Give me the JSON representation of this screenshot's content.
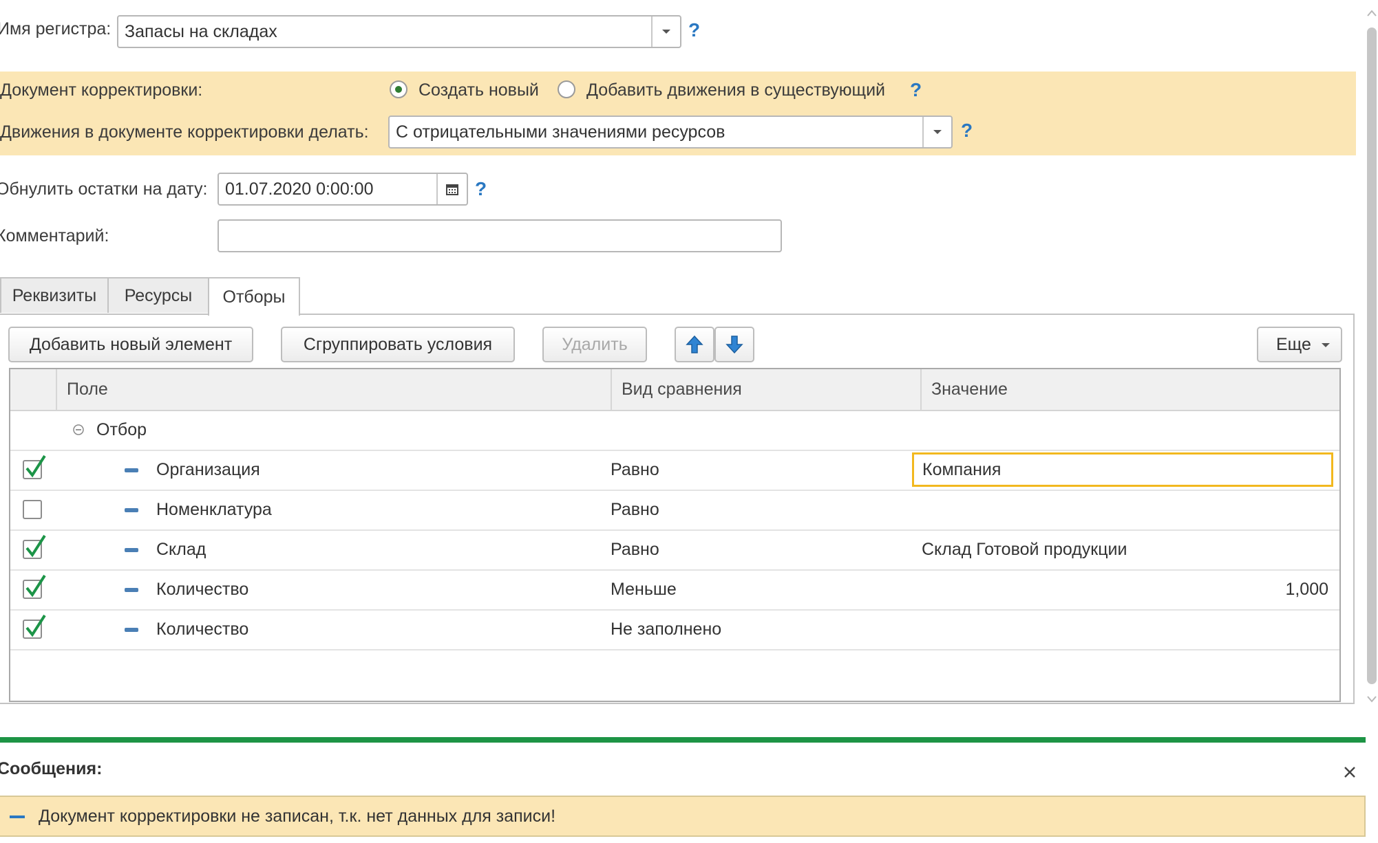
{
  "register": {
    "label": "Имя регистра:",
    "value": "Запасы на складах",
    "help": "?"
  },
  "correction": {
    "label": "Документ корректировки:",
    "options": [
      {
        "label": "Создать новый",
        "selected": true
      },
      {
        "label": "Добавить движения в существующий",
        "selected": false
      }
    ],
    "help": "?",
    "movements_label": "Движения в документе корректировки делать:",
    "movements_value": "С отрицательными значениями ресурсов",
    "movements_help": "?"
  },
  "reset": {
    "label": "Обнулить остатки на дату:",
    "value": "01.07.2020  0:00:00",
    "help": "?"
  },
  "comment": {
    "label": "Комментарий:",
    "value": ""
  },
  "tabs": [
    {
      "label": "Реквизиты",
      "active": false
    },
    {
      "label": "Ресурсы",
      "active": false
    },
    {
      "label": "Отборы",
      "active": true
    }
  ],
  "toolbar": {
    "add_label": "Добавить новый элемент",
    "group_label": "Сгруппировать условия",
    "delete_label": "Удалить",
    "more_label": "Еще"
  },
  "grid": {
    "columns": [
      "Поле",
      "Вид сравнения",
      "Значение"
    ],
    "group": "Отбор",
    "rows": [
      {
        "checked": true,
        "field": "Организация",
        "comparison": "Равно",
        "value": "Компания"
      },
      {
        "checked": false,
        "field": "Номенклатура",
        "comparison": "Равно",
        "value": ""
      },
      {
        "checked": true,
        "field": "Склад",
        "comparison": "Равно",
        "value": "Склад Готовой продукции"
      },
      {
        "checked": true,
        "field": "Количество",
        "comparison": "Меньше",
        "value": "1,000"
      },
      {
        "checked": true,
        "field": "Количество",
        "comparison": "Не заполнено",
        "value": ""
      }
    ]
  },
  "messages": {
    "title": "Сообщения:",
    "items": [
      "Документ корректировки не записан, т.к. нет данных для записи!"
    ]
  },
  "colors": {
    "accent_green": "#1d9445",
    "highlight_yellow": "#fbe6b5",
    "focus_border": "#f2b81e",
    "help_blue": "#2a78c2"
  }
}
